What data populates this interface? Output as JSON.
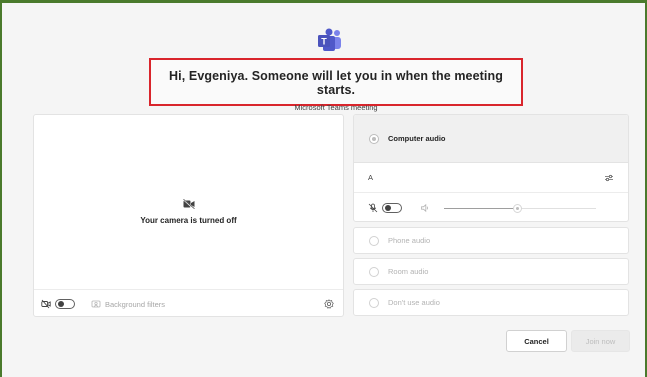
{
  "header": {
    "greeting": "Hi, Evgeniya. Someone will let you in when the meeting starts.",
    "meeting_label": "Microsoft Teams meeting"
  },
  "camera": {
    "status_text": "Your camera is turned off",
    "camera_toggle": "off",
    "background_filters_label": "Background filters"
  },
  "audio": {
    "selected_option_label": "Computer audio",
    "device_name": "A",
    "mic_toggle": "off",
    "volume_level_percent": 49,
    "options": [
      {
        "label": "Phone audio"
      },
      {
        "label": "Room audio"
      },
      {
        "label": "Don't use audio"
      }
    ]
  },
  "actions": {
    "cancel_label": "Cancel",
    "join_label": "Join now"
  },
  "colors": {
    "highlight_border": "#d9252c",
    "teams_brand": "#5059c9",
    "frame_border": "#4a7a2c"
  }
}
